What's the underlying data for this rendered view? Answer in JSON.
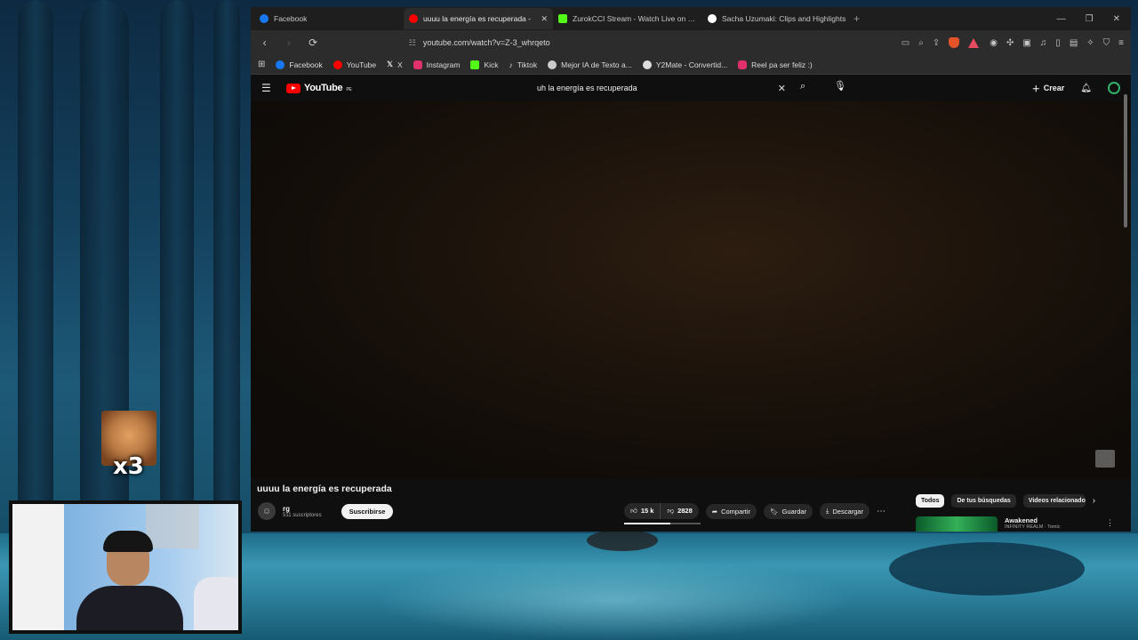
{
  "browser": {
    "tabs": [
      {
        "title": "Facebook",
        "fav_color": "#1877f2",
        "active": false
      },
      {
        "title": "uuuu la energía es recuperada -",
        "fav_color": "#ff0000",
        "active": true
      },
      {
        "title": "ZurokCCI Stream - Watch Live on Kick",
        "fav_color": "#53fc18",
        "active": false
      },
      {
        "title": "Sacha Uzumaki: Clips and Highlights",
        "fav_color": "#ffffff",
        "active": false
      }
    ],
    "new_tab": "+",
    "url": "youtube.com/watch?v=Z-3_whrqeto",
    "bookmarks": [
      {
        "label": "Facebook",
        "color": "#1877f2"
      },
      {
        "label": "YouTube",
        "color": "#ff0000"
      },
      {
        "label": "X",
        "color": "#ffffff"
      },
      {
        "label": "Instagram",
        "color": "#e1306c"
      },
      {
        "label": "Kick",
        "color": "#53fc18"
      },
      {
        "label": "Tiktok",
        "color": "#111111"
      },
      {
        "label": "Mejor IA de Texto a...",
        "color": "#cccccc"
      },
      {
        "label": "Y2Mate - Convertid...",
        "color": "#dddddd"
      },
      {
        "label": "Reel pa ser feliz :)",
        "color": "#e1306c"
      }
    ]
  },
  "youtube": {
    "logo_text": "YouTube",
    "country_code": "PE",
    "search_query": "uh la energía es recuperada",
    "create_label": "Crear",
    "video_title": "uuuu la energía es recuperada",
    "channel_name": "rg",
    "subscribers": "511 suscriptores",
    "subscribe_label": "Suscribirse",
    "likes": "15 k",
    "dislikes": "2828",
    "share_label": "Compartir",
    "save_label": "Guardar",
    "download_label": "Descargar",
    "chips": [
      "Todos",
      "De tus búsquedas",
      "Videos relacionados"
    ],
    "rec_title": "Awakened",
    "rec_channel": "INFINITY REALM · Tomic"
  },
  "overlay": {
    "reaction_multiplier": "x3"
  },
  "colors": {
    "accent_red": "#ff0000",
    "background": "#0f0f0f"
  }
}
